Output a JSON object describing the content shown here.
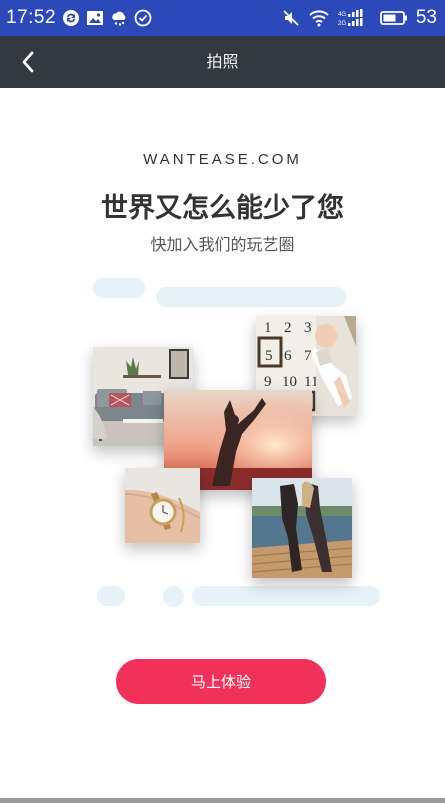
{
  "status_bar": {
    "time": "17:52",
    "battery_level": "53",
    "icons": [
      "sync-icon",
      "image-icon",
      "weather-icon",
      "check-circle-icon",
      "mute-icon",
      "wifi-icon",
      "signal-icon",
      "battery-icon"
    ]
  },
  "header": {
    "title": "拍照",
    "back_icon": "chevron-left-icon"
  },
  "main": {
    "brand": "WANTEASE.COM",
    "headline": "世界又怎么能少了您",
    "subline": "快加入我们的玩艺圈",
    "photos": [
      "living-room-photo",
      "baby-milestone-photo",
      "yoga-pose-photo",
      "wristwatch-photo",
      "couple-on-dock-photo"
    ],
    "baby_calendar_numbers": [
      "1",
      "2",
      "3",
      "5",
      "6",
      "7",
      "9",
      "10",
      "11"
    ]
  },
  "cta": {
    "label": "马上体验"
  },
  "colors": {
    "status_bar": "#2b49b8",
    "top_bar": "#333940",
    "accent": "#f0315a",
    "pill": "#e6f1f8"
  }
}
